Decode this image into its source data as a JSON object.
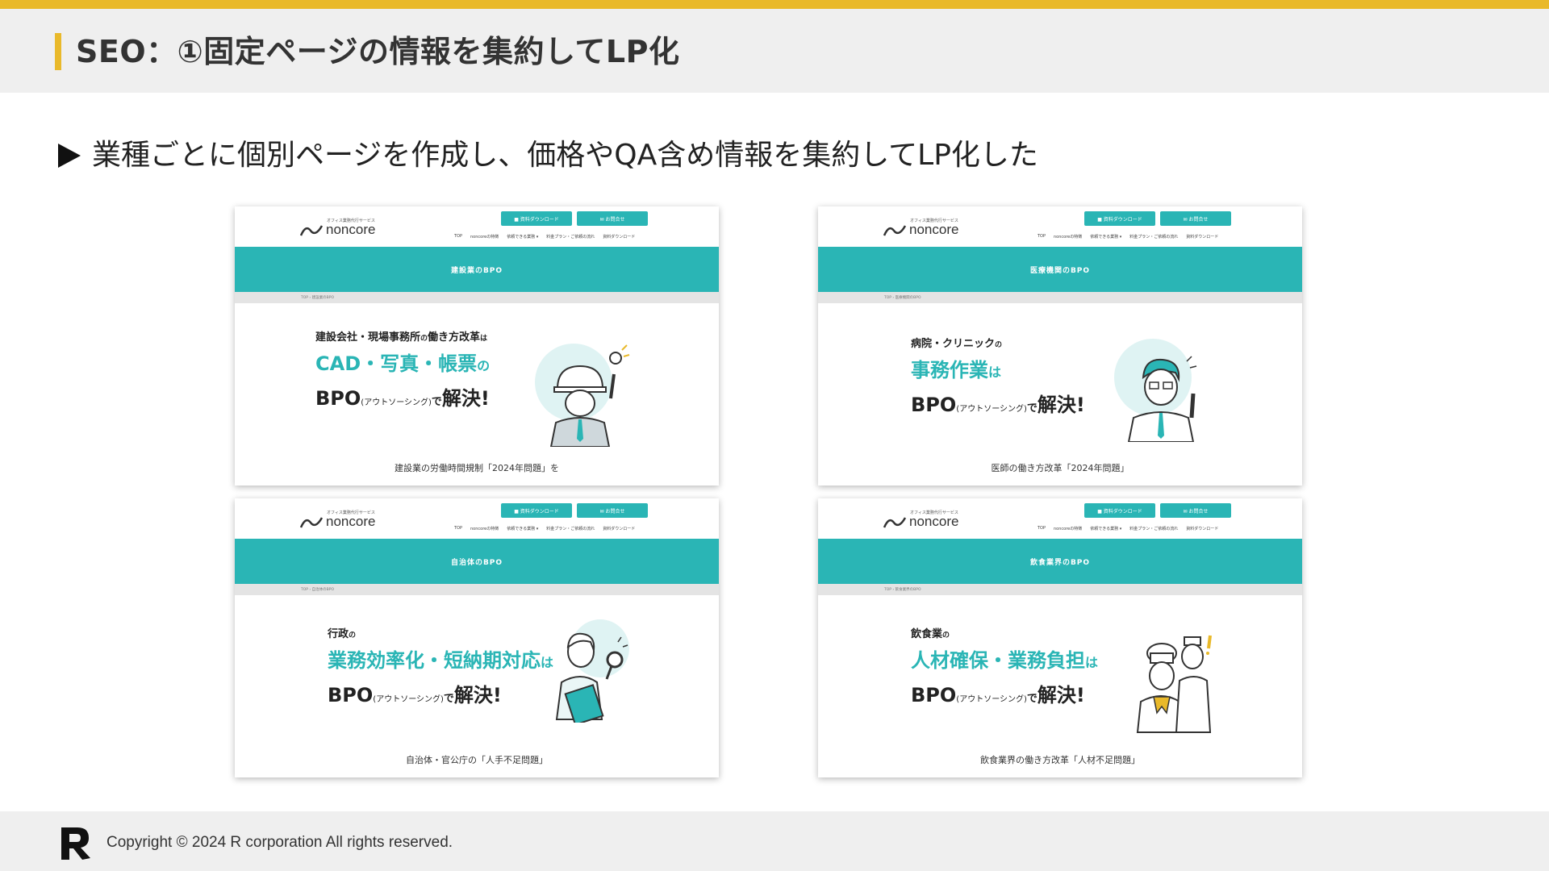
{
  "slide": {
    "title": "SEO：①固定ページの情報を集約してLP化",
    "subtitle": "業種ごとに個別ページを作成し、価格やQA含め情報を集約してLP化した",
    "accent_color": "#e9b92a",
    "teal_color": "#2ab5b5"
  },
  "site_header": {
    "logo_text": "noncore",
    "logo_tagline": "オフィス業務代行サービス",
    "btn_download": "資料ダウンロード",
    "btn_contact": "お問合せ",
    "nav": [
      "TOP",
      "noncoreの特徴",
      "依頼できる業務 ▾",
      "料金プラン・ご依頼の流れ",
      "資料ダウンロード"
    ]
  },
  "screenshots": [
    {
      "banner": "建設業のBPO",
      "breadcrumb": "TOP › 建設業のBPO",
      "line1": "建設会社・現場事務所",
      "line1_no": "の",
      "line1_rest": "働き方改革",
      "line1_ha": "は",
      "line2": "CAD・写真・帳票",
      "line2_suffix": "の",
      "bpo": "BPO",
      "paren": "(アウトソーシング)",
      "de": "で",
      "kaiketsu": "解決!",
      "caption": "建設業の労働時間規制「2024年問題」を",
      "illustration": "construction-worker-icon"
    },
    {
      "banner": "医療機関のBPO",
      "breadcrumb": "TOP › 医療機関のBPO",
      "line1": "病院・クリニック",
      "line1_no": "の",
      "line2": "事務作業",
      "line2_suffix": "は",
      "bpo": "BPO",
      "paren": "(アウトソーシング)",
      "de": "で",
      "kaiketsu": "解決!",
      "caption": "医師の働き方改革「2024年問題」",
      "illustration": "doctor-icon"
    },
    {
      "banner": "自治体のBPO",
      "breadcrumb": "TOP › 自治体のBPO",
      "line1": "行政",
      "line1_no": "の",
      "line2": "業務効率化・短納期対応",
      "line2_suffix": "は",
      "bpo": "BPO",
      "paren": "(アウトソーシング)",
      "de": "で",
      "kaiketsu": "解決!",
      "caption": "自治体・官公庁の「人手不足問題」",
      "illustration": "civil-servant-icon"
    },
    {
      "banner": "飲食業界のBPO",
      "breadcrumb": "TOP › 飲食業界のBPO",
      "line1": "飲食業",
      "line1_no": "の",
      "line2": "人材確保・業務負担",
      "line2_suffix": "は",
      "bpo": "BPO",
      "paren": "(アウトソーシング)",
      "de": "で",
      "kaiketsu": "解決!",
      "caption": "飲食業界の働き方改革「人材不足問題」",
      "illustration": "chef-icon"
    }
  ],
  "footer": {
    "copyright": "Copyright © 2024 R corporation All rights reserved."
  }
}
